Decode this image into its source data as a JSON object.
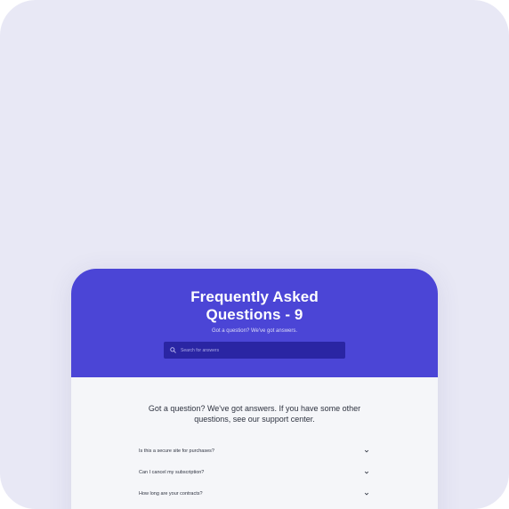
{
  "hero": {
    "title": "Frequently Asked Questions - 9",
    "subtitle": "Got a question? We've got answers.",
    "background_color": "#4b45d6"
  },
  "search": {
    "placeholder": "Search for answers",
    "icon": "search-icon"
  },
  "intro": {
    "text": "Got a question? We've got answers. If you have some other questions, see our support center."
  },
  "faq": {
    "items": [
      {
        "question": "Is this a secure site for purchases?",
        "icon": "chevron-down-icon"
      },
      {
        "question": "Can I cancel my subscription?",
        "icon": "chevron-down-icon"
      },
      {
        "question": "How long are your contracts?",
        "icon": "chevron-down-icon"
      }
    ]
  },
  "colors": {
    "outer_background": "#e8e8f5",
    "accent": "#4b45d6",
    "search_background": "#2a25a3",
    "content_background": "#f5f6f9"
  }
}
